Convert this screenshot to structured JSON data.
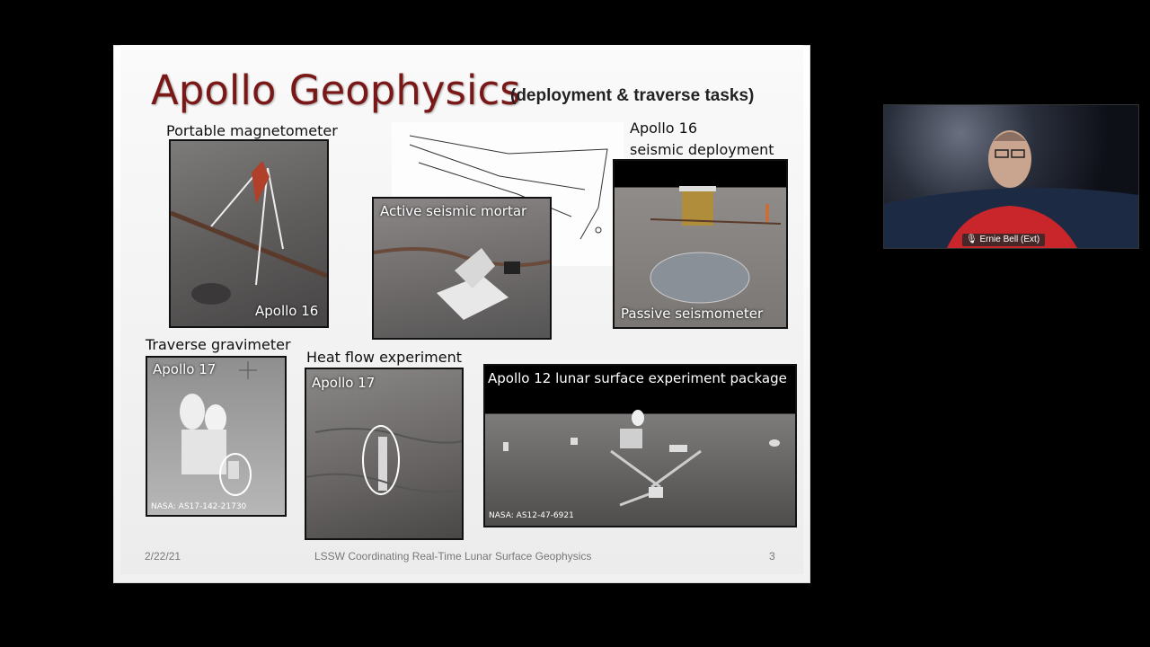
{
  "slide": {
    "title": "Apollo Geophysics",
    "subtitle": "(deployment & traverse tasks)",
    "captions": {
      "magnetometer": "Portable magnetometer",
      "apollo16_line1": "Apollo 16",
      "apollo16_line2": "seismic deployment",
      "gravimeter": "Traverse gravimeter",
      "heatflow": "Heat flow experiment"
    },
    "photo_labels": {
      "magnetometer": "Apollo 16",
      "mortar": "Active seismic mortar",
      "passive": "Passive seismometer",
      "gravimeter": "Apollo 17",
      "gravimeter_credit": "NASA: AS17-142-21730",
      "heatflow": "Apollo 17",
      "alsep": "Apollo 12 lunar surface experiment package",
      "alsep_credit": "NASA: AS12-47-6921"
    },
    "footer": {
      "date": "2/22/21",
      "center": "LSSW  Coordinating Real-Time Lunar Surface Geophysics",
      "page": "3"
    }
  },
  "video": {
    "participant_name": "Ernie Bell (Ext)",
    "icon": "microphone-icon"
  },
  "colors": {
    "title": "#7a1818",
    "background": "#000000"
  }
}
